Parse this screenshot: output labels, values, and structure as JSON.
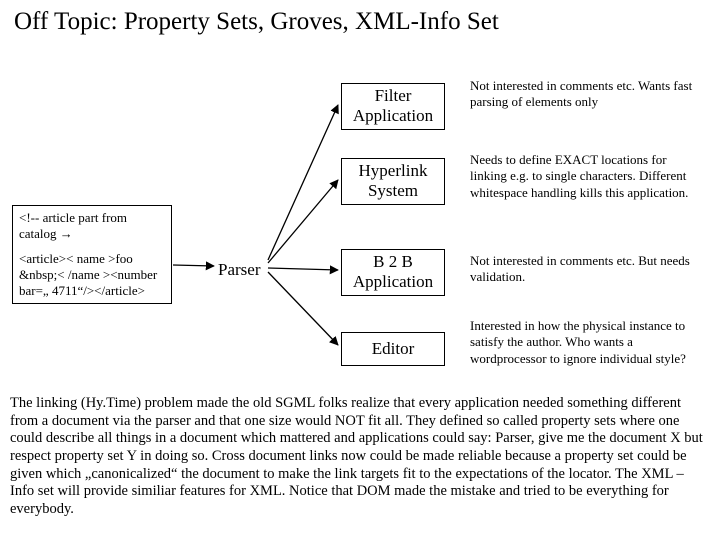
{
  "title": "Off Topic: Property Sets, Groves, XML-Info Set",
  "source": {
    "line1": "<!-- article part from catalog →",
    "line2": "<article>< name >foo &nbsp;< /name ><number bar=„ 4711“/></article>"
  },
  "parser_label": "Parser",
  "apps": {
    "filter": {
      "label": "Filter Application",
      "note": "Not interested in comments etc. Wants fast parsing of elements only"
    },
    "hyperlink": {
      "label": "Hyperlink System",
      "note": "Needs to define EXACT locations for linking e.g. to single characters. Different whitespace handling kills this application."
    },
    "b2b": {
      "label": "B 2 B Application",
      "note": "Not interested in comments etc. But needs validation."
    },
    "editor": {
      "label": "Editor",
      "note": "Interested in how the physical instance to satisfy the author. Who wants a wordprocessor to ignore individual style?"
    }
  },
  "paragraph": "The linking (Hy.Time) problem made the old SGML folks realize that every application needed something different from a document via the parser and that one size would NOT fit all. They defined so called property sets where one could describe all things in a document which mattered and applications could say: Parser, give me the document X but respect property set Y in doing so. Cross document links now could be made reliable because a property set could be given which „canonicalized“ the document to make the link targets fit to the expectations of the locator. The XML – Info set will provide similiar features for XML. Notice that DOM made the mistake and tried to be everything for everybody."
}
